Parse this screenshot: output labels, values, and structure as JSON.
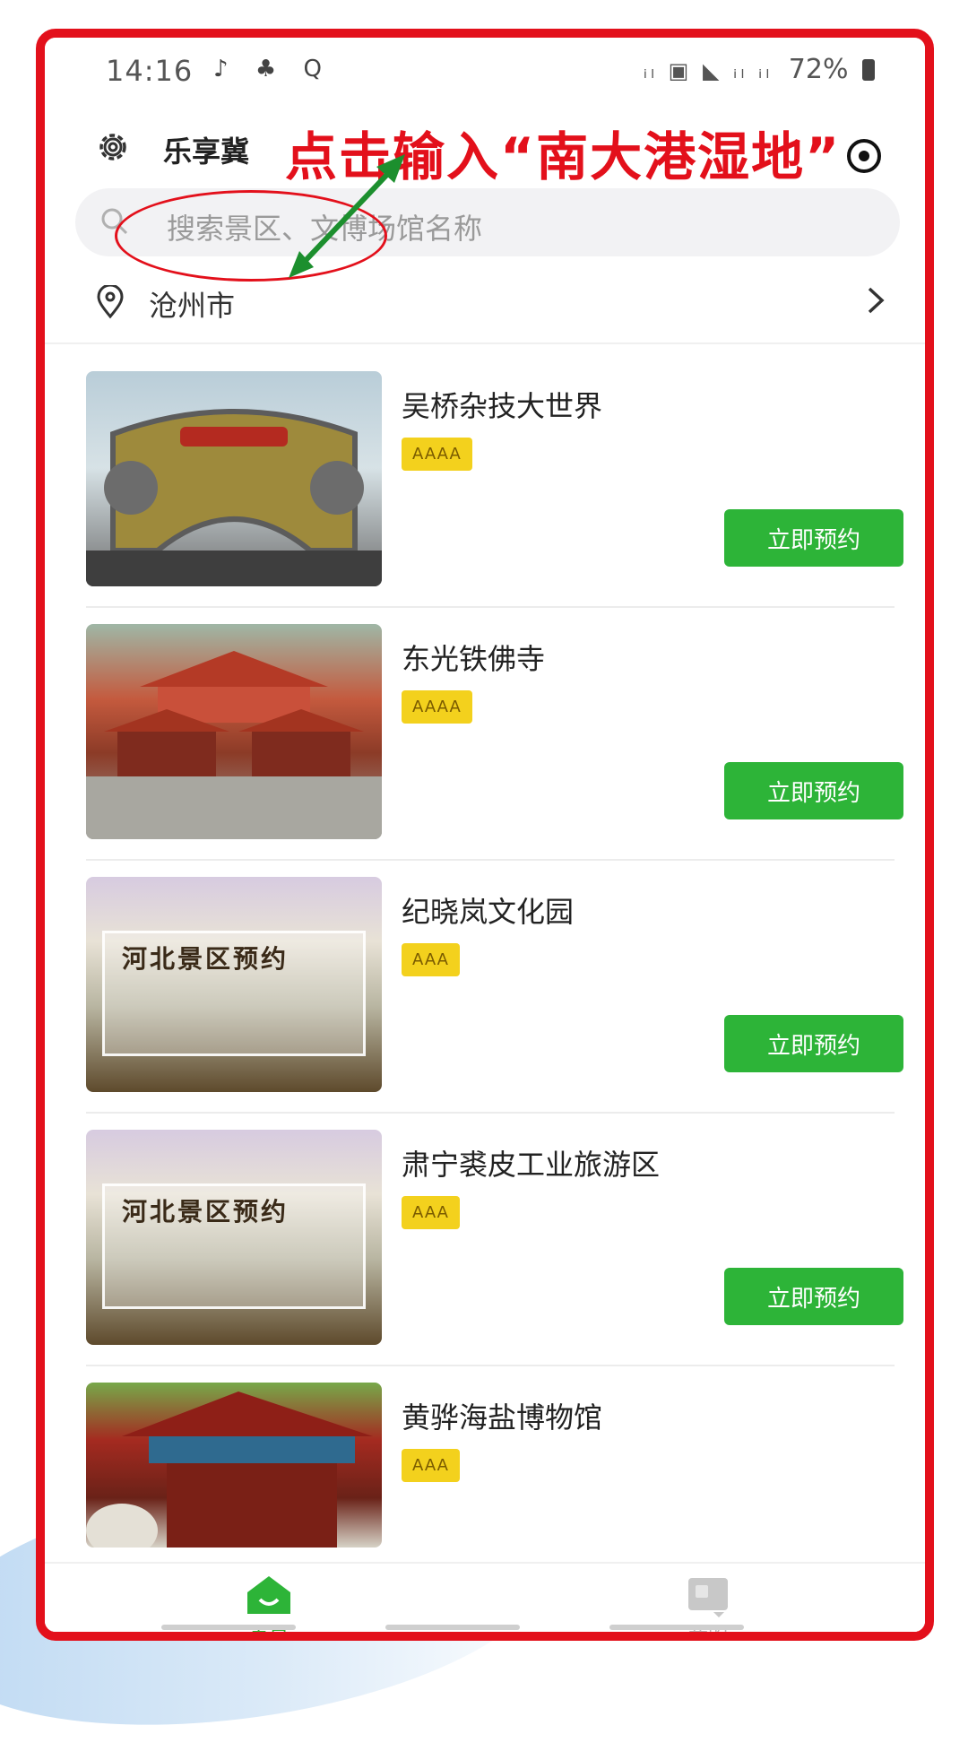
{
  "status_bar": {
    "time": "14:16",
    "left_icons": [
      "♪",
      "♣",
      "Q"
    ],
    "signal": "ᵢₗ ▣ ◣ ᵢₗ ᵢₗ",
    "battery": "72%"
  },
  "header": {
    "title": "乐享冀",
    "annotation": "点击输入“南大港湿地”"
  },
  "search": {
    "placeholder": "搜索景区、文博场馆名称"
  },
  "location": {
    "city": "沧州市"
  },
  "items": [
    {
      "title": "吴桥杂技大世界",
      "level": "AAAA",
      "button": "立即预约"
    },
    {
      "title": "东光铁佛寺",
      "level": "AAAA",
      "button": "立即预约"
    },
    {
      "title": "纪晓岚文化园",
      "level": "AAA",
      "button": "立即预约",
      "image_text": "河北景区预约"
    },
    {
      "title": "肃宁裘皮工业旅游区",
      "level": "AAA",
      "button": "立即预约",
      "image_text": "河北景区预约"
    },
    {
      "title": "黄骅海盐博物馆",
      "level": "AAA"
    }
  ],
  "nav": {
    "home": "首页",
    "mine": "我的"
  },
  "colors": {
    "accent_green": "#2db438",
    "badge_yellow": "#f3d11d",
    "annotation_red": "#e3101b"
  }
}
